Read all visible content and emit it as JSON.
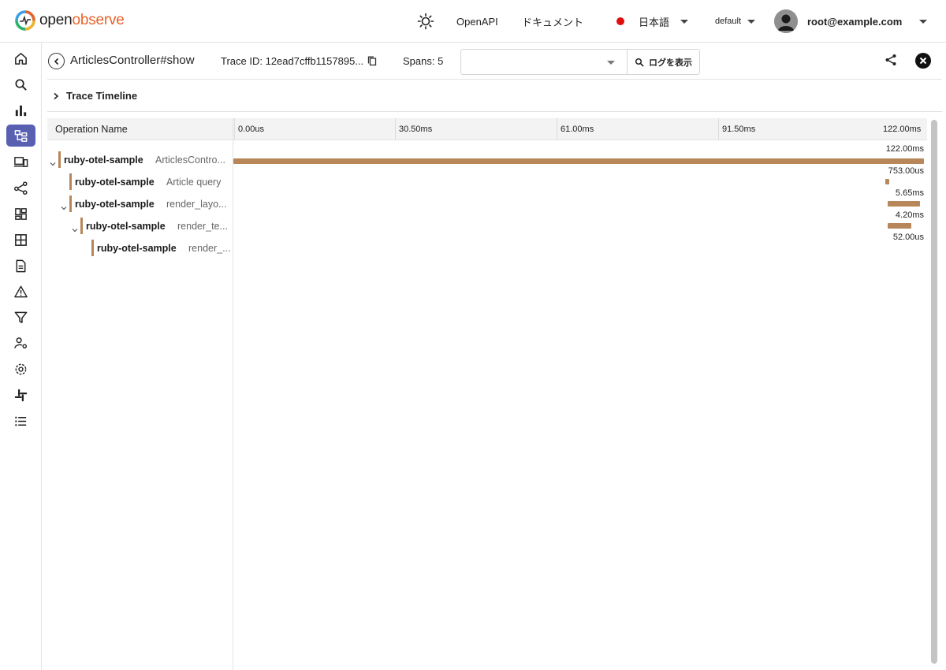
{
  "brand": {
    "name_a": "open",
    "name_b": "observe"
  },
  "header": {
    "openapi": "OpenAPI",
    "docs": "ドキュメント",
    "language": "日本語",
    "org": "default",
    "user": "root@example.com"
  },
  "sidebar": {
    "items": [
      {
        "name": "home-icon",
        "active": false
      },
      {
        "name": "search-icon",
        "active": false
      },
      {
        "name": "metrics-icon",
        "active": false
      },
      {
        "name": "traces-icon",
        "active": true
      },
      {
        "name": "rum-icon",
        "active": false
      },
      {
        "name": "pipelines-icon",
        "active": false
      },
      {
        "name": "dashboards-icon",
        "active": false
      },
      {
        "name": "streams-icon",
        "active": false
      },
      {
        "name": "reports-icon",
        "active": false
      },
      {
        "name": "alerts-icon",
        "active": false
      },
      {
        "name": "functions-icon",
        "active": false
      },
      {
        "name": "iam-icon",
        "active": false
      },
      {
        "name": "settings-icon",
        "active": false
      },
      {
        "name": "slack-icon",
        "active": false
      },
      {
        "name": "about-icon",
        "active": false
      }
    ]
  },
  "trace": {
    "title": "ArticlesController#show",
    "trace_id": "Trace ID: 12ead7cffb1157895...",
    "spans": "Spans: 5",
    "service_filter": "",
    "view_logs": "ログを表示",
    "timeline_label": "Trace Timeline"
  },
  "gantt": {
    "operation_header": "Operation Name",
    "ticks": [
      "0.00us",
      "30.50ms",
      "61.00ms",
      "91.50ms",
      "122.00ms"
    ],
    "total_ms": 122.0,
    "rows": [
      {
        "service": "ruby-otel-sample",
        "operation": "ArticlesContro...",
        "depth": 0,
        "collapsible": true,
        "start_ms": 0.0,
        "duration_ms": 122.0,
        "duration_label": "122.00ms"
      },
      {
        "service": "ruby-otel-sample",
        "operation": "Article query",
        "depth": 1,
        "collapsible": false,
        "start_ms": 115.15,
        "duration_ms": 0.753,
        "duration_label": "753.00us"
      },
      {
        "service": "ruby-otel-sample",
        "operation": "render_layo...",
        "depth": 1,
        "collapsible": true,
        "start_ms": 115.6,
        "duration_ms": 5.65,
        "duration_label": "5.65ms"
      },
      {
        "service": "ruby-otel-sample",
        "operation": "render_te...",
        "depth": 2,
        "collapsible": true,
        "start_ms": 115.6,
        "duration_ms": 4.2,
        "duration_label": "4.20ms"
      },
      {
        "service": "ruby-otel-sample",
        "operation": "render_...",
        "depth": 3,
        "collapsible": false,
        "start_ms": 119.6,
        "duration_ms": 0.052,
        "duration_label": "52.00us"
      }
    ]
  },
  "colors": {
    "accent": "#5960b2",
    "span_bar": "#b7875a",
    "record_dot": "#e00d0d"
  }
}
